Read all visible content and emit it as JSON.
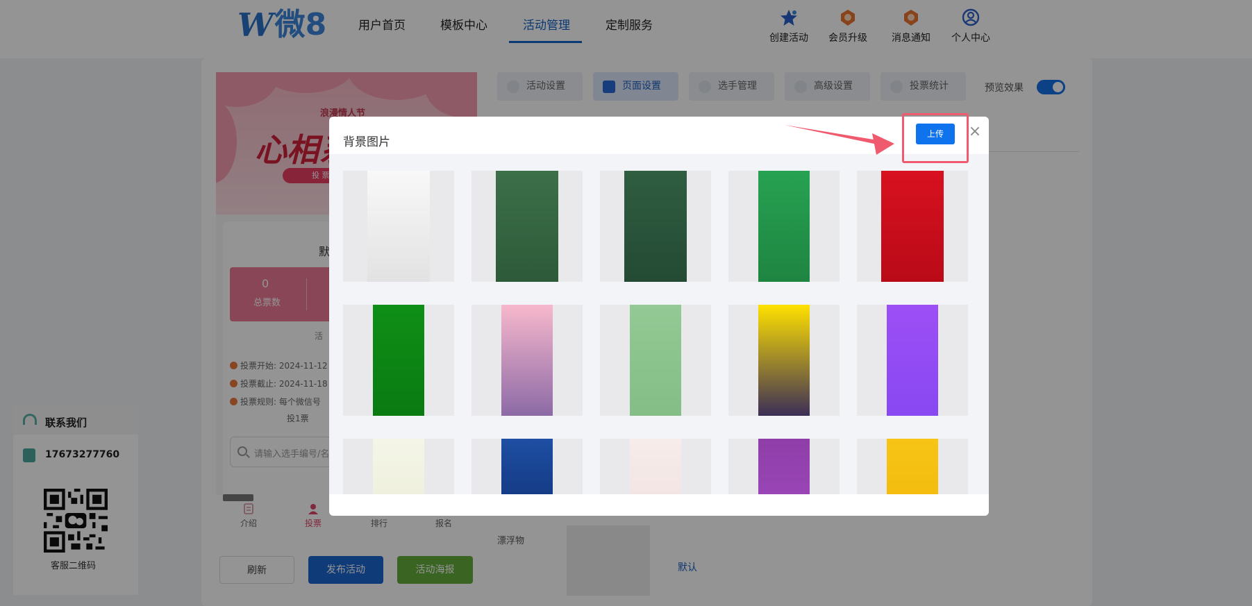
{
  "header": {
    "logo_mark": "W",
    "logo_text": "微8",
    "nav": [
      "用户首页",
      "模板中心",
      "活动管理",
      "定制服务"
    ],
    "active_nav": "活动管理",
    "right_nav": [
      {
        "label": "创建活动",
        "icon": "star-icon"
      },
      {
        "label": "会员升级",
        "icon": "medal-icon"
      },
      {
        "label": "消息通知",
        "icon": "bell-badge-icon"
      },
      {
        "label": "个人中心",
        "icon": "user-circle-icon"
      }
    ]
  },
  "preview": {
    "banner_subtitle": "浪漫情人节",
    "banner_title": "心相系",
    "banner_pill": "投 票",
    "default_title": "默认",
    "stat_value": "0",
    "stat_label": "总票数",
    "mid_char": "活",
    "vote_start": "投票开始:  2024-11-12",
    "vote_end": "投票截止:  2024-11-18",
    "vote_rule": "投票规则:  每个微信号",
    "vote_rule_cont": "投1票",
    "search_placeholder": "请输入选手编号/名",
    "tabs": [
      "介绍",
      "投票",
      "排行",
      "报名"
    ],
    "active_tab": "投票"
  },
  "actions": {
    "refresh": "刷新",
    "publish": "发布活动",
    "poster": "活动海报"
  },
  "toolbar": {
    "tabs": [
      "活动设置",
      "页面设置",
      "选手管理",
      "高级设置",
      "投票统计"
    ],
    "active": "页面设置",
    "preview_label": "预览效果",
    "preview_enabled": true
  },
  "settings": {
    "float_label": "漂浮物",
    "float_default": "默认"
  },
  "contact": {
    "title": "联系我们",
    "phone": "17673277760",
    "qr_label": "客服二维码"
  },
  "modal": {
    "title": "背景图片",
    "upload_label": "上传",
    "close_label": "×",
    "images": [
      {
        "name": "ink-wash-mist",
        "colors": [
          "#f8f8f8",
          "#e2e2e2"
        ]
      },
      {
        "name": "dark-green-1",
        "colors": [
          "#3c7049",
          "#2d5a39"
        ]
      },
      {
        "name": "dark-green-2",
        "colors": [
          "#2f5e41",
          "#244a34"
        ]
      },
      {
        "name": "green-leaves",
        "colors": [
          "#27a252",
          "#1e8541"
        ]
      },
      {
        "name": "red-sparkle",
        "colors": [
          "#d8111f",
          "#b90a18"
        ]
      },
      {
        "name": "green-bamboo",
        "colors": [
          "#0f8f16",
          "#0a7a12"
        ]
      },
      {
        "name": "pink-purple-gradient",
        "colors": [
          "#f7b8cc",
          "#8c6aa6"
        ]
      },
      {
        "name": "mint-floral",
        "colors": [
          "#93c994",
          "#84be86"
        ]
      },
      {
        "name": "yellow-dark-party",
        "colors": [
          "#ffe100",
          "#3b2e56"
        ]
      },
      {
        "name": "violet-gradient",
        "colors": [
          "#9d4ff5",
          "#8848f2"
        ]
      },
      {
        "name": "bamboo-cream",
        "colors": [
          "#f4f5e7",
          "#eaecd5"
        ]
      },
      {
        "name": "navy-blue",
        "colors": [
          "#1e4ea3",
          "#0c2a6a"
        ]
      },
      {
        "name": "blush-pink",
        "colors": [
          "#f6ecea",
          "#f0dedc"
        ]
      },
      {
        "name": "purple-rays",
        "colors": [
          "#8f3ea8",
          "#a34cc4"
        ]
      },
      {
        "name": "gold-yellow",
        "colors": [
          "#f7c515",
          "#f0b40a"
        ]
      }
    ]
  },
  "colors": {
    "primary": "#0f73ed",
    "nav_active": "#1463c8",
    "publish_bg": "#1b66d1",
    "poster_bg": "#62ad3a",
    "annotation": "#f05a6e"
  }
}
